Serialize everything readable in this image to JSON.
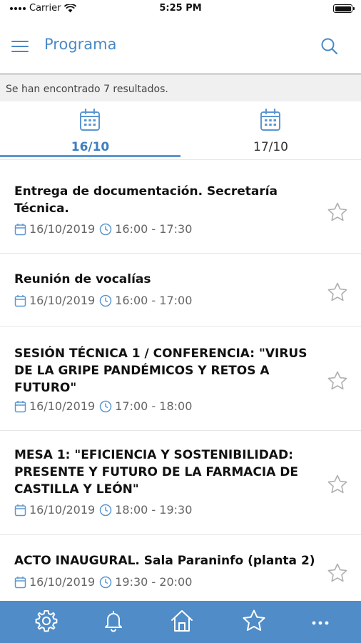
{
  "status_bar": {
    "carrier": "Carrier",
    "time": "5:25 PM"
  },
  "header": {
    "title": "Programa",
    "menu_icon": "hamburger-menu-icon",
    "search_icon": "search-icon"
  },
  "results": {
    "text": "Se han encontrado 7 resultados."
  },
  "date_tabs": [
    {
      "label": "16/10",
      "active": true,
      "icon": "calendar-icon"
    },
    {
      "label": "17/10",
      "active": false,
      "icon": "calendar-icon"
    }
  ],
  "events": [
    {
      "title": "Entrega de documentación. Secretaría Técnica.",
      "date": "16/10/2019",
      "time": "16:00 - 17:30"
    },
    {
      "title": "Reunión de vocalías",
      "date": "16/10/2019",
      "time": "16:00 - 17:00"
    },
    {
      "title": "SESIÓN TÉCNICA 1 / CONFERENCIA: \"VIRUS DE LA GRIPE PANDÉMICOS Y RETOS A FUTURO\"",
      "date": "16/10/2019",
      "time": "17:00 - 18:00"
    },
    {
      "title": "MESA 1: \"EFICIENCIA Y SOSTENIBILIDAD: PRESENTE Y FUTURO DE LA FARMACIA DE CASTILLA Y LEÓN\"",
      "date": "16/10/2019",
      "time": "18:00 - 19:30"
    },
    {
      "title": "ACTO INAUGURAL. Sala Paraninfo (planta 2)",
      "date": "16/10/2019",
      "time": "19:30 - 20:00"
    }
  ],
  "tab_bar": [
    {
      "icon": "gear-icon"
    },
    {
      "icon": "bell-icon"
    },
    {
      "icon": "home-icon"
    },
    {
      "icon": "star-icon"
    },
    {
      "icon": "more-icon"
    }
  ],
  "colors": {
    "accent": "#4a8ac7",
    "tab_bar": "#4f8cc8",
    "active_tab": "#3d7ec0"
  }
}
